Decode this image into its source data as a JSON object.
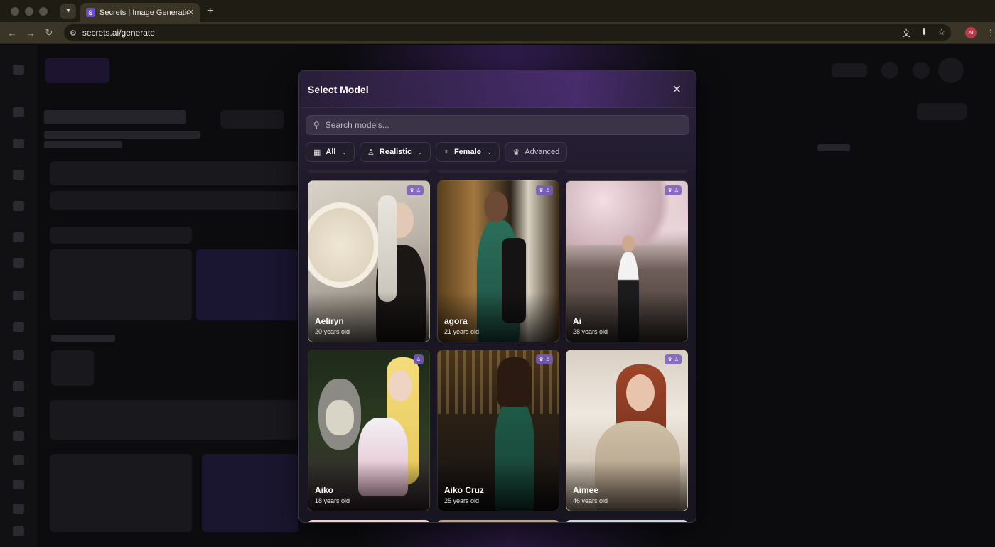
{
  "browser": {
    "tab_title": "Secrets | Image Generation",
    "favicon_letter": "S",
    "url": "secrets.ai/generate",
    "profile_initials": "AI"
  },
  "modal": {
    "title": "Select Model",
    "search_placeholder": "Search models...",
    "filters": [
      {
        "label": "All",
        "icon": "grid-icon"
      },
      {
        "label": "Realistic",
        "icon": "person-icon"
      },
      {
        "label": "Female",
        "icon": "female-icon"
      },
      {
        "label": "Advanced",
        "icon": "crown-icon"
      }
    ],
    "models": [
      {
        "name": "Aeliryn",
        "age": "20 years old"
      },
      {
        "name": "agora",
        "age": "21 years old"
      },
      {
        "name": "Ai",
        "age": "28 years old"
      },
      {
        "name": "Aiko",
        "age": "18 years old"
      },
      {
        "name": "Aiko Cruz",
        "age": "25 years old"
      },
      {
        "name": "Aimee",
        "age": "46 years old"
      }
    ]
  }
}
